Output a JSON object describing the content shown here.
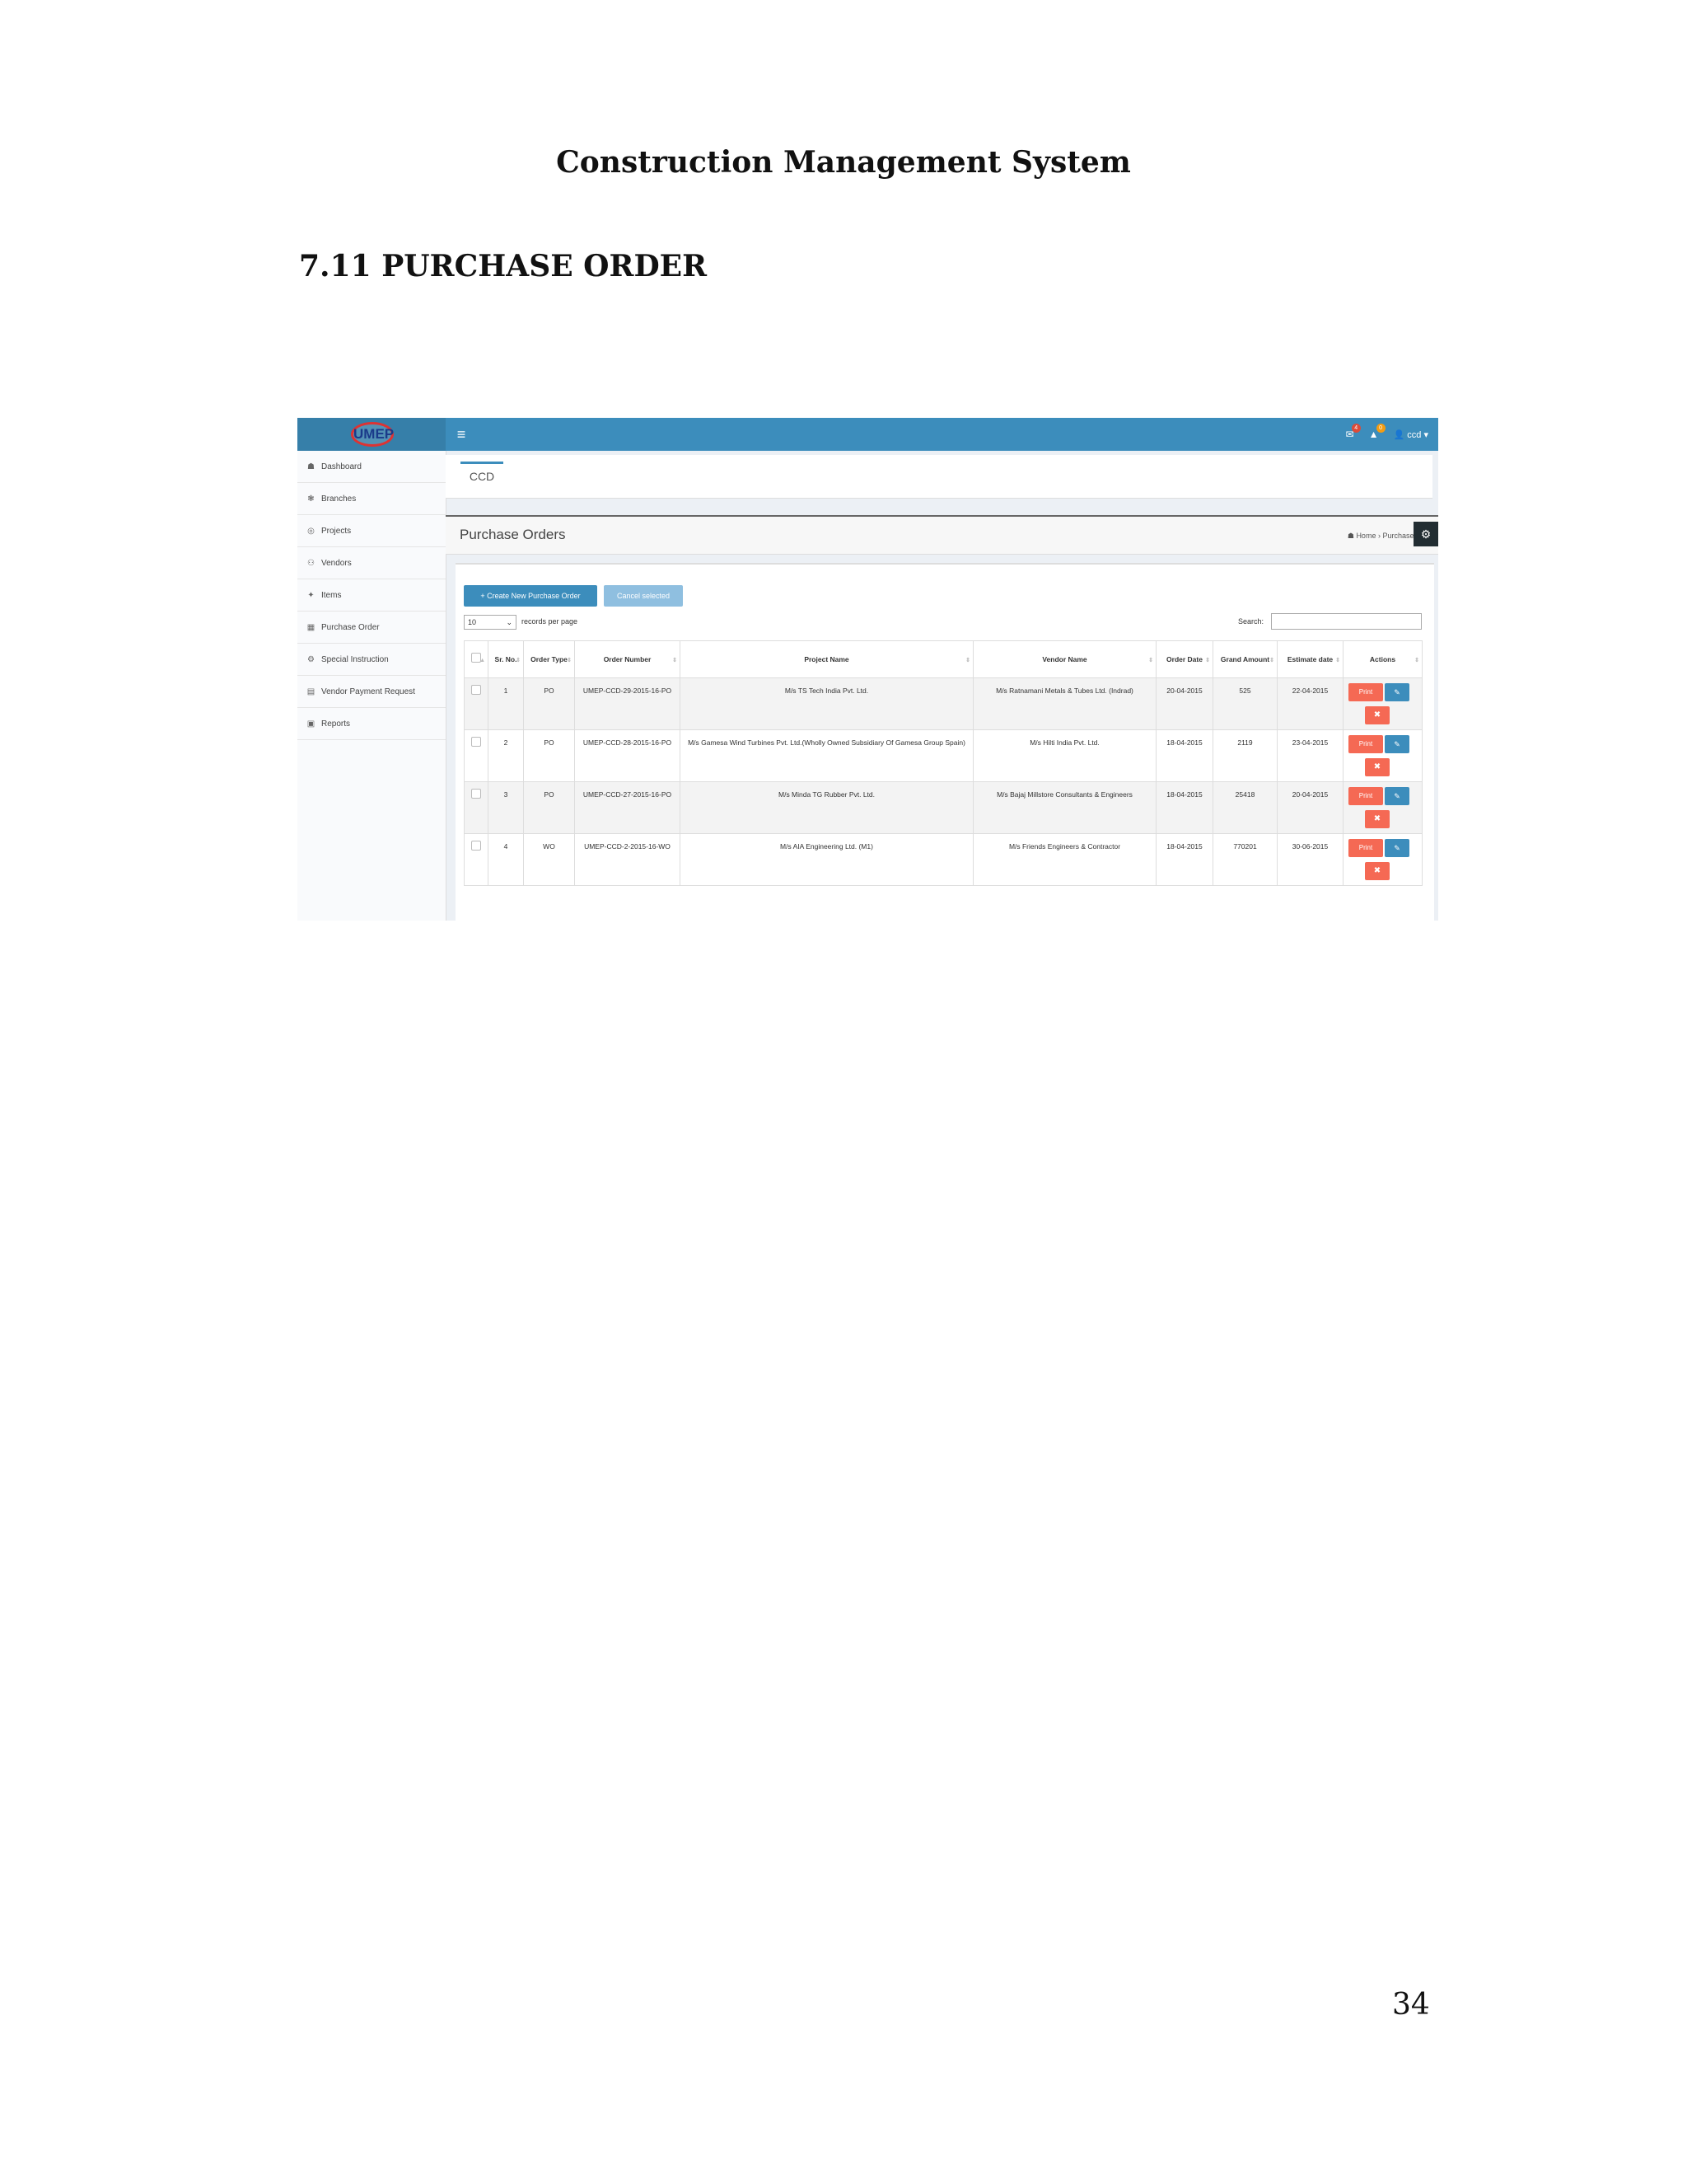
{
  "document": {
    "title": "Construction Management System",
    "section_heading": "7.11 PURCHASE ORDER",
    "page_number": "34"
  },
  "app": {
    "logo_text": "UMEP",
    "user_label": "ccd ▾",
    "notifications": [
      {
        "icon": "envelope-icon",
        "count": "4"
      },
      {
        "icon": "bell-icon",
        "count": "0"
      }
    ],
    "sidebar": [
      {
        "label": "Dashboard",
        "icon": "dashboard-icon"
      },
      {
        "label": "Branches",
        "icon": "branches-icon"
      },
      {
        "label": "Projects",
        "icon": "projects-icon"
      },
      {
        "label": "Vendors",
        "icon": "vendors-icon"
      },
      {
        "label": "Items",
        "icon": "items-icon"
      },
      {
        "label": "Purchase Order",
        "icon": "purchase-order-icon"
      },
      {
        "label": "Special Instruction",
        "icon": "special-instruction-icon"
      },
      {
        "label": "Vendor Payment Request",
        "icon": "vendor-payment-icon"
      },
      {
        "label": "Reports",
        "icon": "reports-icon"
      }
    ],
    "tab_label": "CCD",
    "page_title": "Purchase Orders",
    "breadcrumb": {
      "home": "Home",
      "current": "Purchase O"
    },
    "toolbar": {
      "create_label": "+ Create New Purchase Order",
      "cancel_label": "Cancel selected",
      "page_length": "10",
      "page_length_label": "records per page",
      "search_label": "Search:"
    },
    "table": {
      "columns": [
        "Sr. No.",
        "Order Type",
        "Order Number",
        "Project Name",
        "Vendor Name",
        "Order Date",
        "Grand Amount",
        "Estimate date",
        "Actions"
      ],
      "print_label": "Print",
      "rows": [
        {
          "sr": "1",
          "type": "PO",
          "number": "UMEP-CCD-29-2015-16-PO",
          "project": "M/s TS Tech India Pvt. Ltd.",
          "vendor": "M/s Ratnamani Metals & Tubes Ltd. (Indrad)",
          "date": "20-04-2015",
          "amount": "525",
          "estimate": "22-04-2015"
        },
        {
          "sr": "2",
          "type": "PO",
          "number": "UMEP-CCD-28-2015-16-PO",
          "project": "M/s Gamesa Wind Turbines Pvt. Ltd.(Wholly Owned Subsidiary Of Gamesa Group Spain)",
          "vendor": "M/s Hilti India Pvt. Ltd.",
          "date": "18-04-2015",
          "amount": "2119",
          "estimate": "23-04-2015"
        },
        {
          "sr": "3",
          "type": "PO",
          "number": "UMEP-CCD-27-2015-16-PO",
          "project": "M/s Minda TG Rubber Pvt. Ltd.",
          "vendor": "M/s Bajaj Millstore Consultants & Engineers",
          "date": "18-04-2015",
          "amount": "25418",
          "estimate": "20-04-2015"
        },
        {
          "sr": "4",
          "type": "WO",
          "number": "UMEP-CCD-2-2015-16-WO",
          "project": "M/s AIA Engineering Ltd. (M1)",
          "vendor": "M/s Friends Engineers & Contractor",
          "date": "18-04-2015",
          "amount": "770201",
          "estimate": "30-06-2015"
        }
      ]
    }
  }
}
